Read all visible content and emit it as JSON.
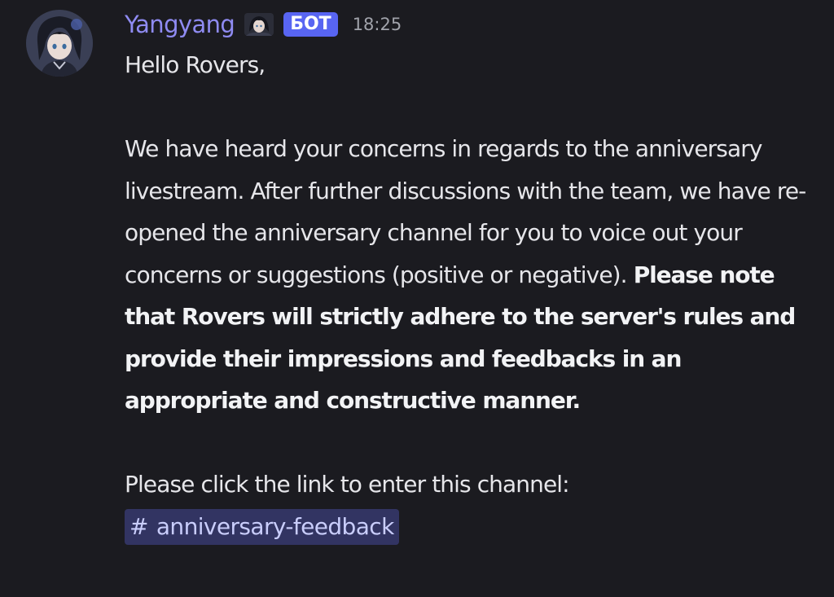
{
  "message": {
    "author": {
      "username": "Yangyang",
      "avatar_icon": "character-avatar-icon",
      "role_icon": "character-role-icon",
      "bot_tag": "БОТ",
      "timestamp": "18:25"
    },
    "greeting": "Hello Rovers,",
    "paragraph_plain": "We have heard your concerns in regards to the anniversary livestream. After further discussions with the team, we have re-opened the anniversary channel for you to voice out your concerns or suggestions (positive or negative). ",
    "paragraph_bold": "Please note that Rovers will strictly adhere to the server's rules and provide their impressions and feedbacks in an appropriate and constructive manner.",
    "link_prompt": "Please click the link to enter this channel:",
    "channel_mention": {
      "hash": "#",
      "name": "anniversary-feedback"
    }
  },
  "colors": {
    "background": "#1b1b20",
    "username": "#8f8bf2",
    "bot_tag": "#5865f2",
    "mention_bg": "#323462",
    "mention_text": "#c9cdfb"
  }
}
